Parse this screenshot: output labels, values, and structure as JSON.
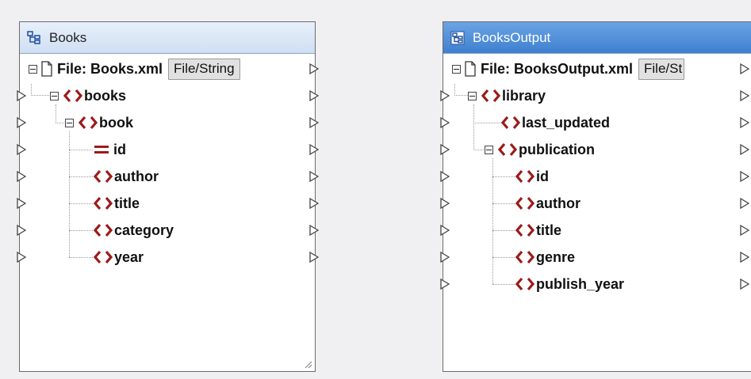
{
  "books": {
    "title": "Books",
    "file_label": "File: Books.xml",
    "file_button": "File/String",
    "nodes": [
      {
        "label": "books",
        "kind": "element"
      },
      {
        "label": "book",
        "kind": "element"
      },
      {
        "label": "id",
        "kind": "attribute"
      },
      {
        "label": "author",
        "kind": "element"
      },
      {
        "label": "title",
        "kind": "element"
      },
      {
        "label": "category",
        "kind": "element"
      },
      {
        "label": "year",
        "kind": "element"
      }
    ]
  },
  "books_output": {
    "title": "BooksOutput",
    "file_label": "File: BooksOutput.xml",
    "file_button": "File/St",
    "nodes": [
      {
        "label": "library",
        "kind": "element"
      },
      {
        "label": "last_updated",
        "kind": "element"
      },
      {
        "label": "publication",
        "kind": "element"
      },
      {
        "label": "id",
        "kind": "element"
      },
      {
        "label": "author",
        "kind": "element"
      },
      {
        "label": "title",
        "kind": "element"
      },
      {
        "label": "genre",
        "kind": "element"
      },
      {
        "label": "publish_year",
        "kind": "element"
      }
    ]
  },
  "colors": {
    "tag_icon": "#9b1b1b",
    "header_active": "#4a8ad8",
    "header_inactive": "#dbe7f6"
  }
}
